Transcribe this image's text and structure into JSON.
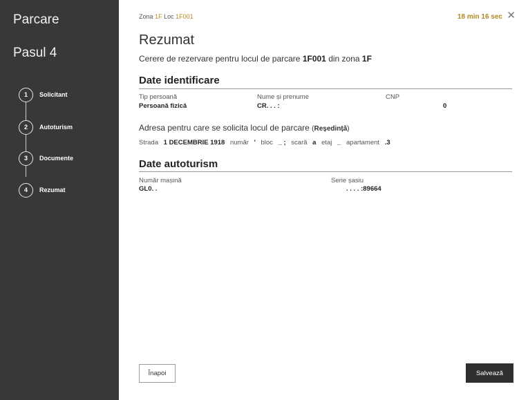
{
  "sidebar": {
    "title": "Parcare",
    "step": "Pasul 4",
    "steps": [
      {
        "num": "1",
        "label": "Solicitant"
      },
      {
        "num": "2",
        "label": "Autoturism"
      },
      {
        "num": "3",
        "label": "Documente"
      },
      {
        "num": "4",
        "label": "Rezumat"
      }
    ]
  },
  "topbar": {
    "zone_label": "Zona",
    "zone_value": "1F",
    "loc_label": "Loc",
    "loc_value": "1F001",
    "timer": "18 min 16 sec",
    "close_icon": "close-icon"
  },
  "summary": {
    "title": "Rezumat",
    "subtitle_prefix": "Cerere de rezervare pentru locul de parcare",
    "subtitle_loc": "1F001",
    "subtitle_mid": "din zona",
    "subtitle_zone": "1F"
  },
  "identificare": {
    "heading": "Date identificare",
    "tip_label": "Tip persoană",
    "tip_value": "Persoană fizică",
    "nume_label": "Nume și prenume",
    "nume_value": "CR. .  .      :",
    "cnp_label": "CNP",
    "cnp_value": "0",
    "adresa_title": "Adresa pentru care se solicita locul de parcare",
    "adresa_type": "Reședință",
    "adresa": {
      "strada_label": "Strada",
      "strada_value": "1 DECEMBRIE 1918",
      "numar_label": "număr",
      "numar_value": "'",
      "bloc_label": "bloc",
      "bloc_value": "_ ;",
      "scara_label": "scară",
      "scara_value": "a",
      "etaj_label": "etaj",
      "etaj_value": "_",
      "apartament_label": "apartament",
      "apartament_value": ".3"
    }
  },
  "autoturism": {
    "heading": "Date autoturism",
    "numar_label": "Număr mașină",
    "numar_value": "GL0. .",
    "serie_label": "Serie șasiu",
    "serie_value": ". . . . :89664"
  },
  "buttons": {
    "back": "Înapoi",
    "save": "Salvează"
  }
}
